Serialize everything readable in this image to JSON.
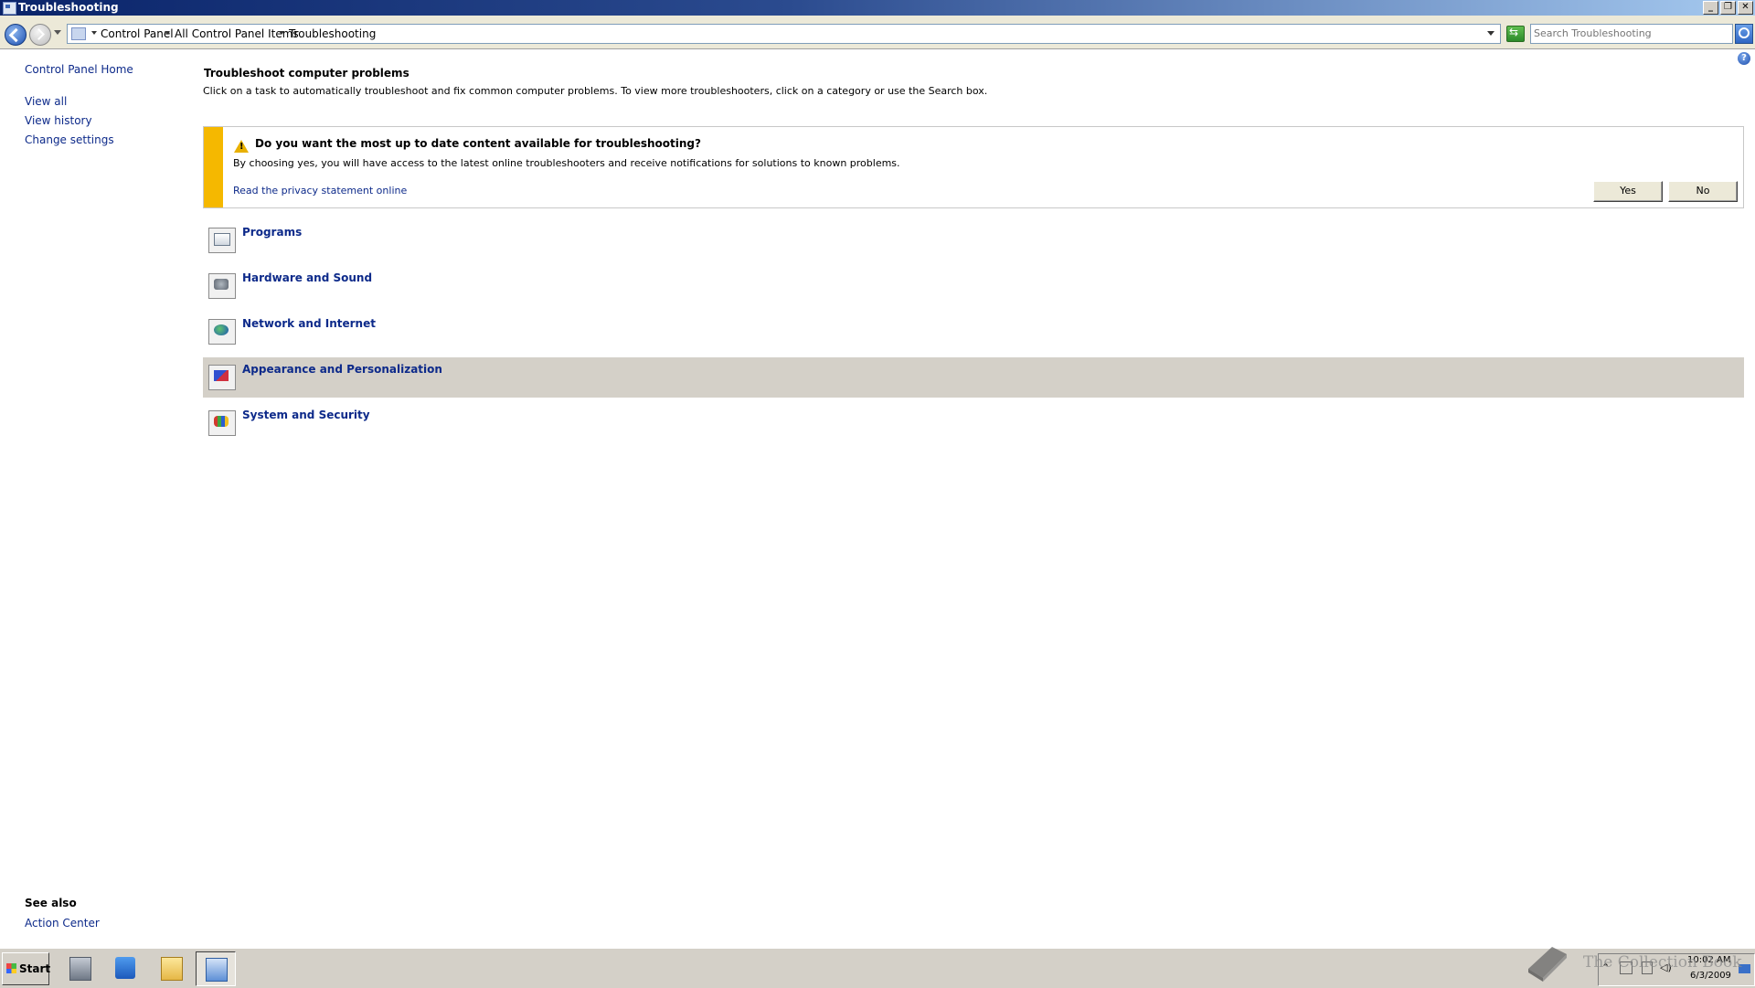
{
  "window": {
    "title": "Troubleshooting"
  },
  "address_bar": {
    "breadcrumbs": [
      "Control Panel",
      "All Control Panel Items",
      "Troubleshooting"
    ],
    "search_placeholder": "Search Troubleshooting"
  },
  "left_pane": {
    "home_link": "Control Panel Home",
    "links": [
      "View all",
      "View history",
      "Change settings"
    ],
    "see_also_title": "See also",
    "see_also_links": [
      "Action Center"
    ]
  },
  "main": {
    "title": "Troubleshoot computer problems",
    "description": "Click on a task to automatically troubleshoot and fix common computer problems. To view more troubleshooters, click on a category or use the Search box."
  },
  "infobar": {
    "question": "Do you want the most up to date content available for troubleshooting?",
    "description": "By choosing yes, you will have access to the latest online troubleshooters and receive notifications for solutions to known problems.",
    "privacy_link": "Read the privacy statement online",
    "yes_label": "Yes",
    "no_label": "No",
    "stripe_color": "#f5b800"
  },
  "categories": [
    {
      "label": "Programs",
      "icon": "programs-icon"
    },
    {
      "label": "Hardware and Sound",
      "icon": "hardware-sound-icon"
    },
    {
      "label": "Network and Internet",
      "icon": "network-internet-icon"
    },
    {
      "label": "Appearance and Personalization",
      "icon": "appearance-icon",
      "selected": true
    },
    {
      "label": "System and Security",
      "icon": "system-security-icon"
    }
  ],
  "taskbar": {
    "start_label": "Start",
    "clock_time": "10:02 AM",
    "clock_date": "6/3/2009",
    "watermark": "The Collection Book"
  },
  "colors": {
    "link": "#0d2a8a",
    "selected_row": "#d4d0c8",
    "titlebar_start": "#0a246a"
  }
}
